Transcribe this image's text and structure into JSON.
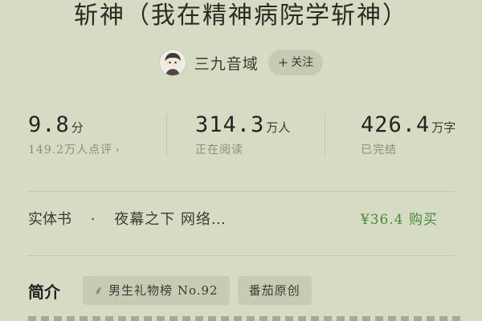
{
  "book": {
    "title": "斩神（我在精神病院学斩神）"
  },
  "author": {
    "name": "三九音域",
    "avatar_icon": "cartoon-avatar-icon",
    "follow_label": "关注",
    "follow_icon": "plus-icon"
  },
  "stats": {
    "rating": {
      "value": "9.8",
      "unit": "分",
      "sub": "149.2万人点评",
      "sub_icon": "chevron-right-icon"
    },
    "readers": {
      "value": "314.3",
      "unit": "万人",
      "sub": "正在阅读"
    },
    "words": {
      "value": "426.4",
      "unit": "万字",
      "sub": "已完结"
    }
  },
  "edition": {
    "type": "实体书",
    "separator": "·",
    "publisher": "夜幕之下 网络…",
    "buy_label": "¥36.4 购买",
    "buy_color": "#4d8a3a"
  },
  "intro": {
    "label": "简介",
    "tags": [
      {
        "text": "男生礼物榜 No.92",
        "icon": "laurel-icon"
      },
      {
        "text": "番茄原创"
      }
    ]
  },
  "theme": {
    "background": "#d6dcc4",
    "chip_background": "#c6ccb3"
  }
}
